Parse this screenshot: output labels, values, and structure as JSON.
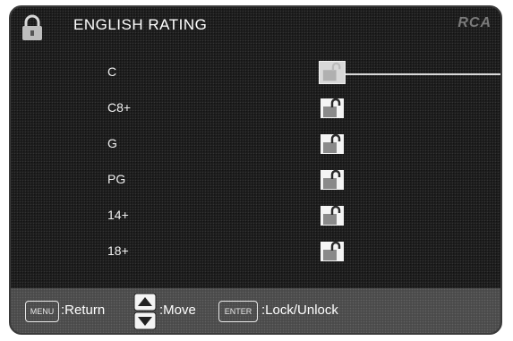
{
  "header": {
    "title": "ENGLISH RATING",
    "logo": "RCA",
    "icon": "lock-icon"
  },
  "ratings": [
    {
      "label": "C",
      "selected": true,
      "icon": "unlocked-lock-icon"
    },
    {
      "label": "C8+",
      "selected": false,
      "icon": "unlocked-lock-icon"
    },
    {
      "label": "G",
      "selected": false,
      "icon": "unlocked-lock-icon"
    },
    {
      "label": "PG",
      "selected": false,
      "icon": "unlocked-lock-icon"
    },
    {
      "label": "14+",
      "selected": false,
      "icon": "unlocked-lock-icon"
    },
    {
      "label": "18+",
      "selected": false,
      "icon": "unlocked-lock-icon"
    }
  ],
  "footer": {
    "menu_key": "MENU",
    "menu_text": ":Return",
    "move_text": ":Move",
    "enter_key": "ENTER",
    "enter_text": ":Lock/Unlock"
  }
}
